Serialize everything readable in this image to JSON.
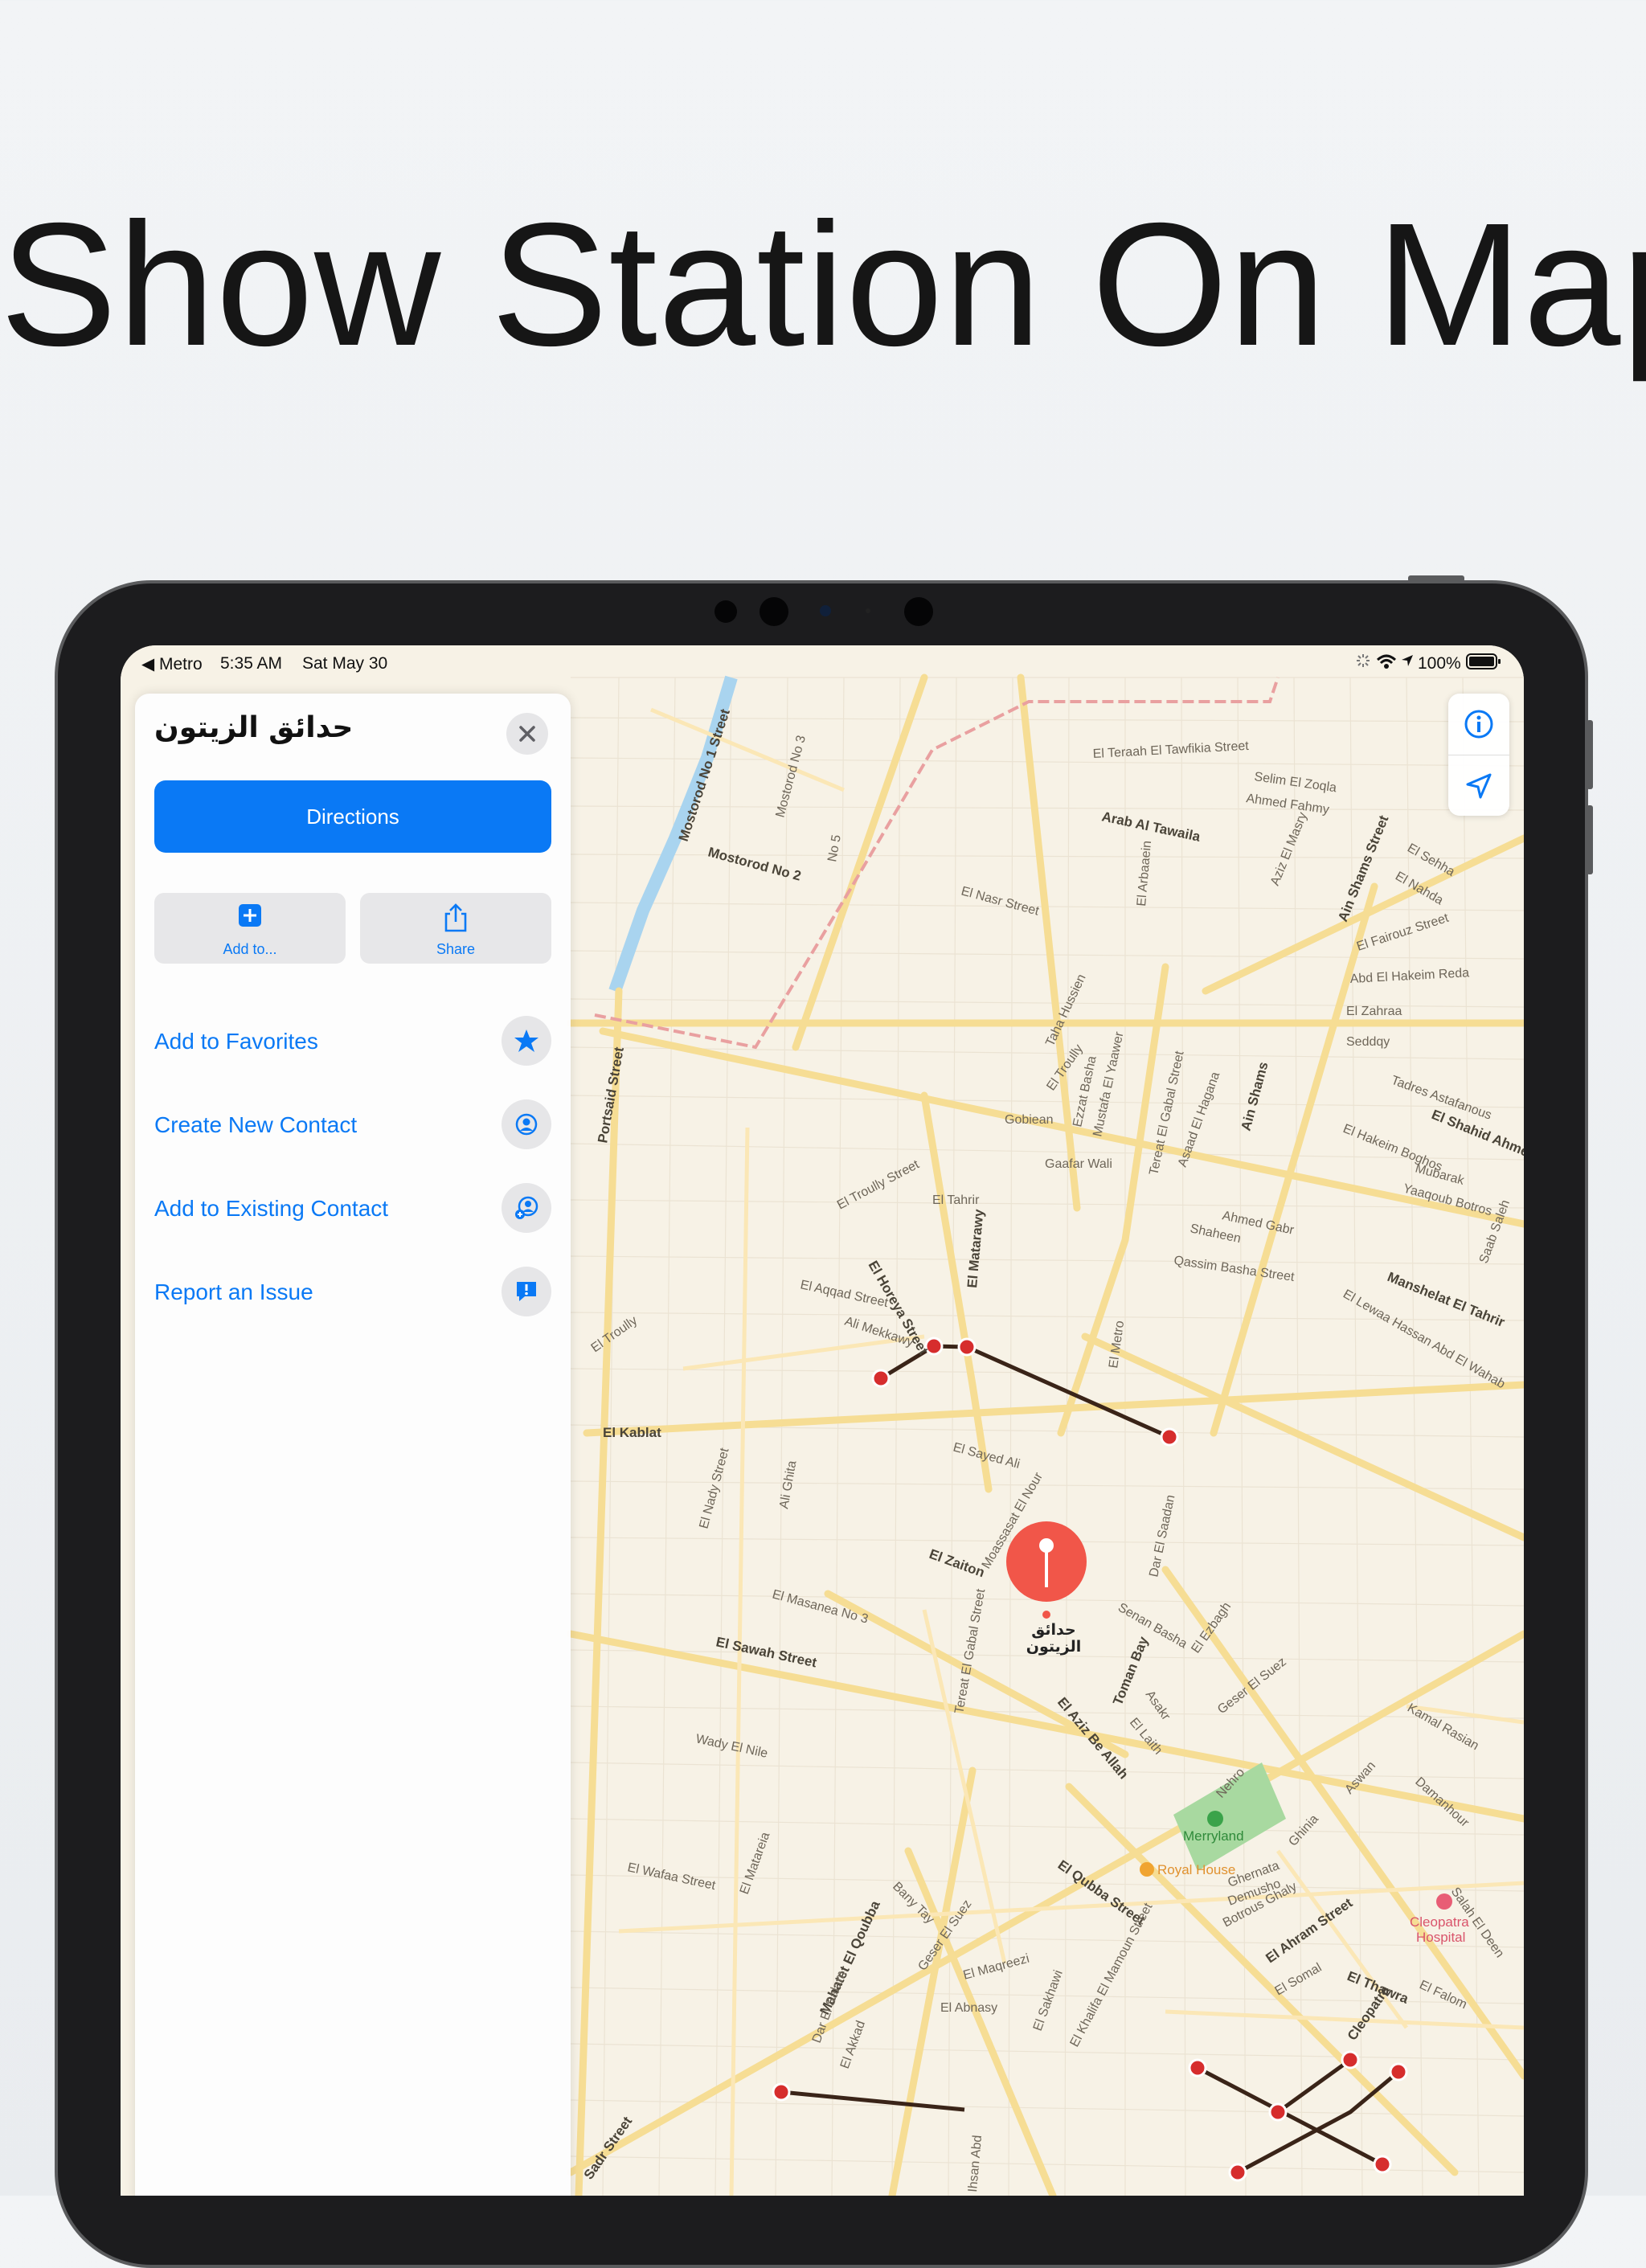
{
  "headline": "Show Station On Map",
  "status_bar": {
    "back_app": "◀ Metro",
    "time": "5:35 AM",
    "date": "Sat May 30",
    "battery": "100%"
  },
  "place_card": {
    "title": "حدائق الزيتون",
    "directions_label": "Directions",
    "add_to_label": "Add to...",
    "share_label": "Share",
    "actions": [
      {
        "label": "Add to Favorites",
        "icon": "star-icon"
      },
      {
        "label": "Create New Contact",
        "icon": "contact-icon"
      },
      {
        "label": "Add to Existing Contact",
        "icon": "add-contact-icon"
      },
      {
        "label": "Report an Issue",
        "icon": "report-icon"
      }
    ]
  },
  "map_controls": {
    "info_icon": "info-icon",
    "location_icon": "location-arrow-icon"
  },
  "map": {
    "pin_label": "حدائق\nالزيتون",
    "streets": [
      "Mostorod No 1 Street",
      "Mostorod No 3",
      "Mostorod No 2",
      "No 5",
      "Portsaid Street",
      "El Teraah El Tawfikia Street",
      "Selim El Zoqla",
      "Ahmed Fahmy",
      "Arab Al Tawaila",
      "El Arbaaein",
      "Aziz El Masry",
      "Ain Shams Street",
      "El Sehha",
      "El Nahda",
      "El Fairouz Street",
      "Abd El Hakeim Reda",
      "El Zahraa",
      "Seddqy",
      "El Nasr Street",
      "Taha Hussien",
      "El Troully",
      "Ezzat Basha",
      "Mustafa El Yaawer",
      "Gobiean",
      "Gaafar Wali",
      "Tereat El Gabal Street",
      "Asaad El Hagana",
      "Ain Shams",
      "Tadres Astafanous",
      "El Shahid Ahmed",
      "El Hakeim Boghos",
      "Mubarak",
      "Yaaqoub Botros",
      "Ahmed Gabr",
      "Shaheen",
      "Qassim Basha Street",
      "Saab Saleh",
      "Manshelat El Tahrir",
      "El Lewaa Hassan Abd El Wahab",
      "El Troully Street",
      "El Tahrir",
      "El Horeya Street",
      "El Matarawy",
      "El Aqqad Street",
      "Ali Mekkawy",
      "El Kablat",
      "El Sayed Ali",
      "El Nady Street",
      "Ali Ghita",
      "El Zaiton",
      "Moassasat El Nour",
      "El Masanea No 3",
      "El Sawah Street",
      "Wady El Nile",
      "El Matareia",
      "El Wafaa Street",
      "Tereat El Gabal Street",
      "Senan Basha",
      "El Ezbagh",
      "Toman Bay",
      "Asakr",
      "El Aziz Be Allah",
      "El Laith",
      "Geser El Suez",
      "Kamal Rasian",
      "Damanhour",
      "Aswan",
      "Nehro",
      "Ghinia",
      "Ghernata",
      "Demusho",
      "Botrous Ghaly",
      "El Qubba Street",
      "Mahatet El Qoubba",
      "Bany Tay",
      "Geser El Suez",
      "El Maqreezi",
      "El Abnasy",
      "Dar El Salam",
      "El Akkad",
      "El Sakhawi",
      "El Khalifa El Mamoun Street",
      "El Ahram Street",
      "El Somal",
      "El Thawra",
      "Cleopatra",
      "El Falom",
      "Salah El Deen",
      "El Troully",
      "Dar El Saadan",
      "El Metro",
      "Sadr Street",
      "Ihsan Abd"
    ],
    "pois": {
      "park": "Merryland",
      "restaurant": "Royal House",
      "hospital": "Cleopatra\nHospital"
    }
  }
}
